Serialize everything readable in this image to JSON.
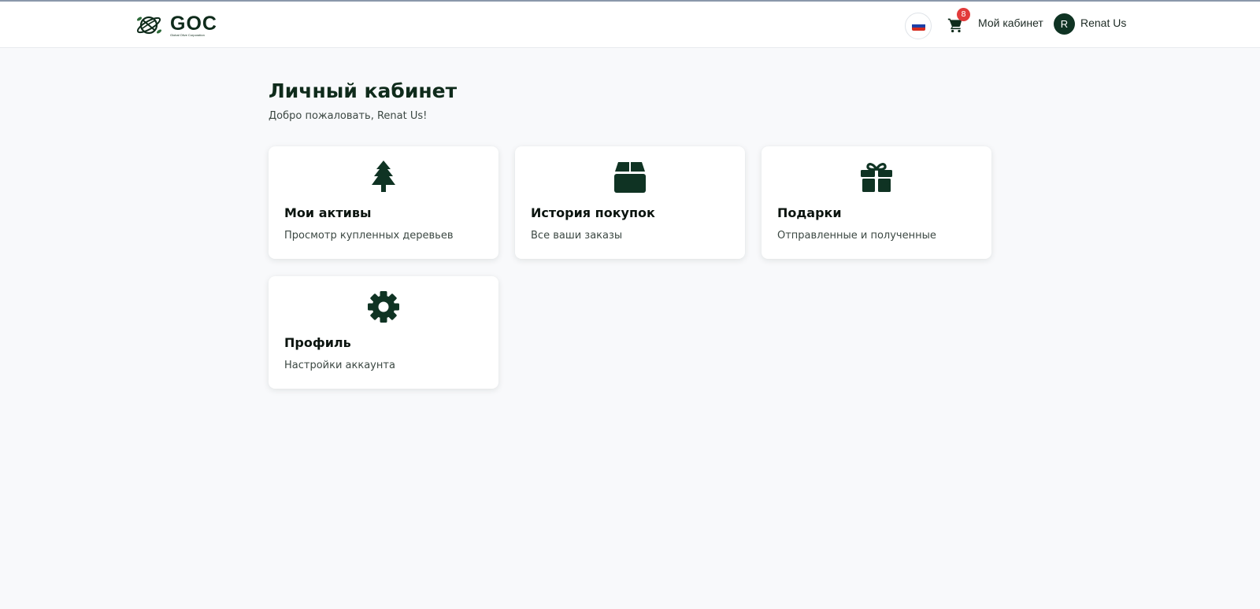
{
  "header": {
    "logo_text": "GOC",
    "logo_subtext": "Global Olive Corporation",
    "cart_count": "8",
    "cabinet_link": "Мой кабинет",
    "avatar_initial": "R",
    "user_name": "Renat Us",
    "language_flag": "russia-flag-icon"
  },
  "main": {
    "title": "Личный кабинет",
    "welcome": "Добро пожаловать, Renat Us!",
    "cards": [
      {
        "icon": "tree-icon",
        "title": "Мои активы",
        "description": "Просмотр купленных деревьев"
      },
      {
        "icon": "box-icon",
        "title": "История покупок",
        "description": "Все ваши заказы"
      },
      {
        "icon": "gift-icon",
        "title": "Подарки",
        "description": "Отправленные и полученные"
      },
      {
        "icon": "gear-icon",
        "title": "Профиль",
        "description": "Настройки аккаунта"
      }
    ]
  },
  "colors": {
    "brand_dark_green": "#0f3323",
    "badge_red": "#e23b3b",
    "page_background": "#f8f9fb",
    "card_background": "#ffffff"
  }
}
